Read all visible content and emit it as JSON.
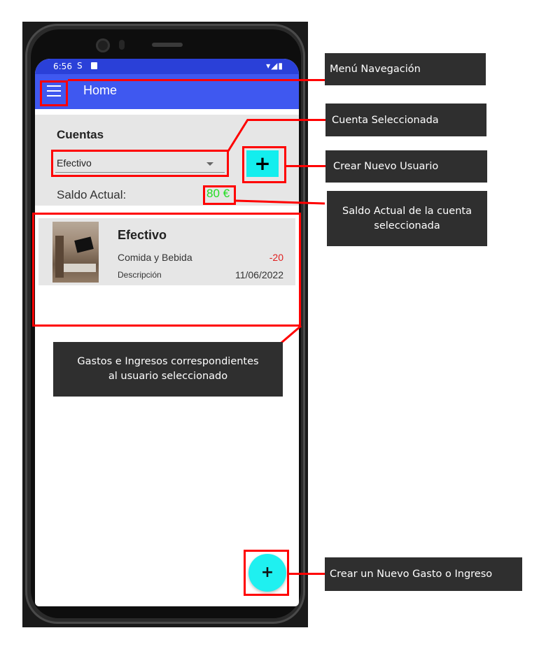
{
  "status_bar": {
    "time": "6:56",
    "sim_icon": "S",
    "right_icons": "▾◢▮"
  },
  "app_bar": {
    "menu_icon": "hamburger-icon",
    "title": "Home"
  },
  "accounts": {
    "label": "Cuentas",
    "selected": "Efectivo",
    "add_button_label": "+",
    "balance_label": "Saldo Actual:",
    "balance_value": "80 €"
  },
  "transactions": [
    {
      "account": "Efectivo",
      "category": "Comida y Bebida",
      "amount": "-20",
      "description": "Descripción",
      "date": "11/06/2022"
    }
  ],
  "fab_label": "+",
  "annotations": {
    "menu": "Menú Navegación",
    "account_selected": "Cuenta Seleccionada",
    "create_user": "Crear Nuevo Usuario",
    "balance": "Saldo Actual de la cuenta\nseleccionada",
    "transactions": "Gastos e Ingresos correspondientes\nal usuario seleccionado",
    "create_entry": "Crear un Nuevo Gasto o Ingreso"
  },
  "colors": {
    "status_bar": "#2a40d8",
    "app_bar": "#3f58f0",
    "accent_cyan": "#13eeee",
    "balance_green": "#22dd22",
    "amount_red": "#e02020",
    "highlight_red": "#ff0000",
    "callout_bg": "#2f2f2f"
  }
}
